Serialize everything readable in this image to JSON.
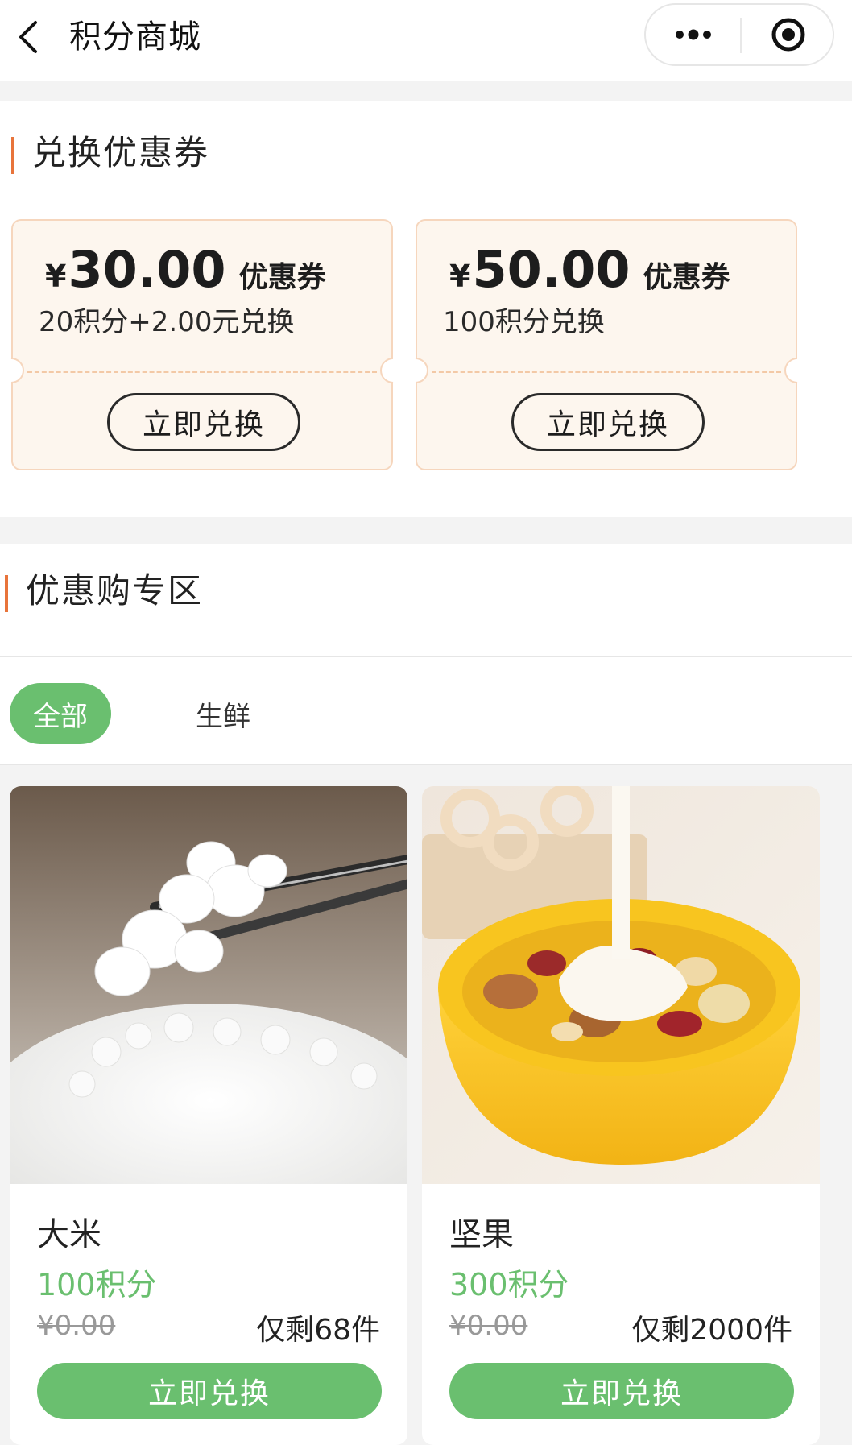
{
  "header": {
    "title": "积分商城",
    "back_icon": "chevron-left-icon",
    "more_icon": "more-dots-icon",
    "target_icon": "target-icon"
  },
  "coupons_section": {
    "title": "兑换优惠券",
    "accent": "#e8743b",
    "coupons": [
      {
        "currency": "¥",
        "amount": "30.00",
        "unit": "优惠券",
        "cost": "20积分+2.00元兑换",
        "button": "立即兑换"
      },
      {
        "currency": "¥",
        "amount": "50.00",
        "unit": "优惠券",
        "cost": "100积分兑换",
        "button": "立即兑换"
      }
    ]
  },
  "deals_section": {
    "title": "优惠购专区",
    "tabs": [
      {
        "label": "全部",
        "active": true
      },
      {
        "label": "生鲜",
        "active": false
      }
    ],
    "accent_green": "#6abf6f",
    "products": [
      {
        "name": "大米",
        "points": "100积分",
        "original_price": "¥0.00",
        "stock": "仅剩68件",
        "button": "立即兑换",
        "image": "rice-photo"
      },
      {
        "name": "坚果",
        "points": "300积分",
        "original_price": "¥0.00",
        "stock": "仅剩2000件",
        "button": "立即兑换",
        "image": "nuts-yogurt-photo"
      }
    ]
  }
}
